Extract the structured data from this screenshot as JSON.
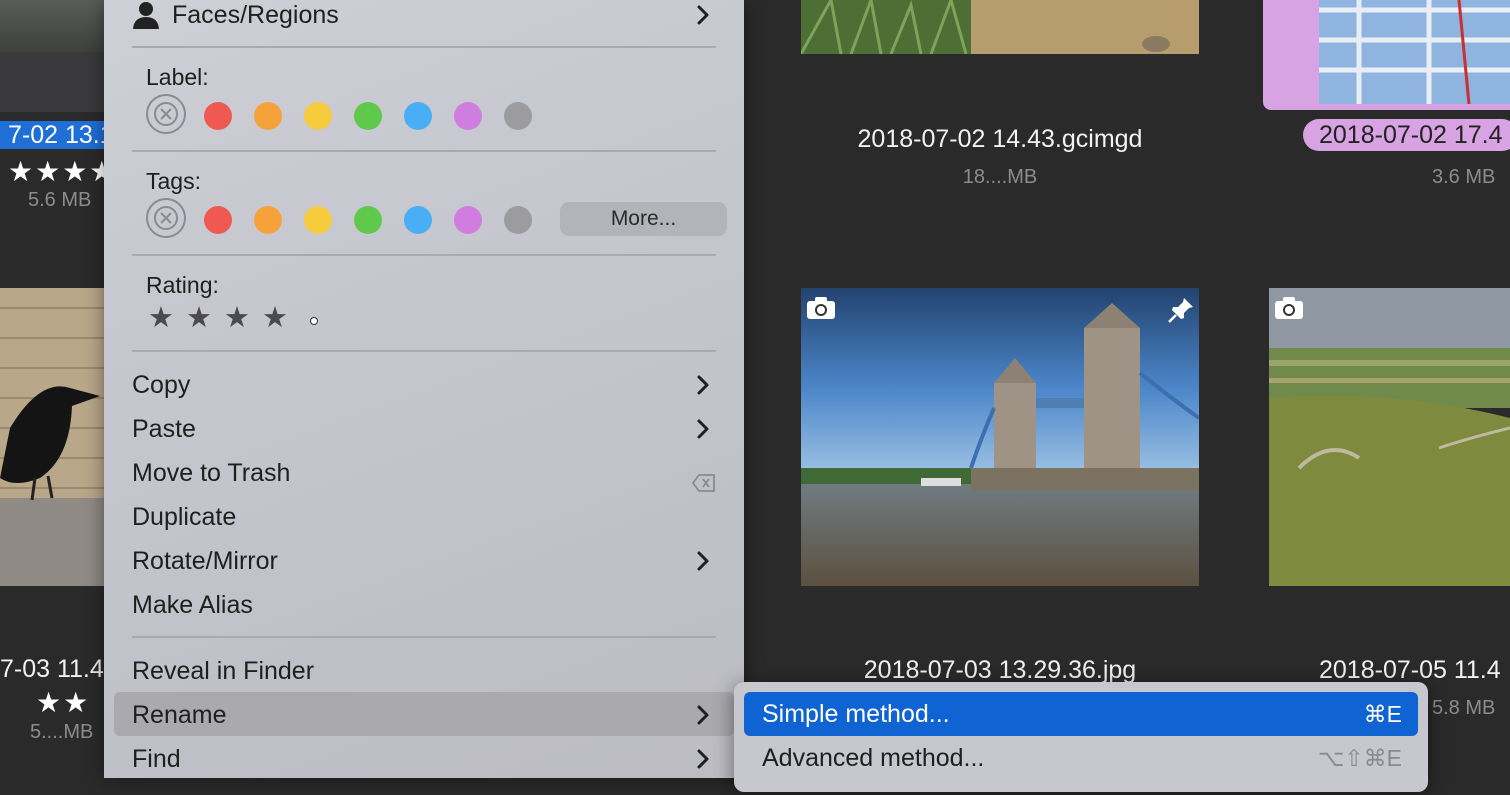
{
  "grid": {
    "left_col": {
      "top_caption": "7-02 13.1",
      "top_stars": "★★★★",
      "top_size": "5.6 MB",
      "bottom_caption": "7-03 11.4",
      "bottom_stars": "★★",
      "bottom_size": "5....MB"
    },
    "mid_col": {
      "top_caption": "2018-07-02 14.43.gcimgd",
      "top_size": "18....MB",
      "bottom_caption": "2018-07-03 13.29.36.jpg"
    },
    "right_col": {
      "top_caption": "2018-07-02 17.4",
      "top_size": "3.6 MB",
      "bottom_caption": "2018-07-05 11.4",
      "bottom_size": "5.8 MB"
    }
  },
  "menu": {
    "faces_regions": "Faces/Regions",
    "label_title": "Label:",
    "tags_title": "Tags:",
    "more_button": "More...",
    "rating_title": "Rating:",
    "items": [
      {
        "label": "Copy"
      },
      {
        "label": "Paste"
      },
      {
        "label": "Move to Trash"
      },
      {
        "label": "Duplicate"
      },
      {
        "label": "Rotate/Mirror"
      },
      {
        "label": "Make Alias"
      },
      {
        "label": "Reveal in Finder"
      },
      {
        "label": "Rename"
      },
      {
        "label": "Find"
      }
    ],
    "color_dots": [
      "#ee5a52",
      "#f6a23b",
      "#f5cc3e",
      "#5ec94b",
      "#4aaef4",
      "#cf7ee0",
      "#9c9ca0"
    ]
  },
  "submenu": {
    "items": [
      {
        "label": "Simple method...",
        "shortcut": "⌘E"
      },
      {
        "label": "Advanced method...",
        "shortcut": "⌥⇧⌘E"
      }
    ]
  }
}
